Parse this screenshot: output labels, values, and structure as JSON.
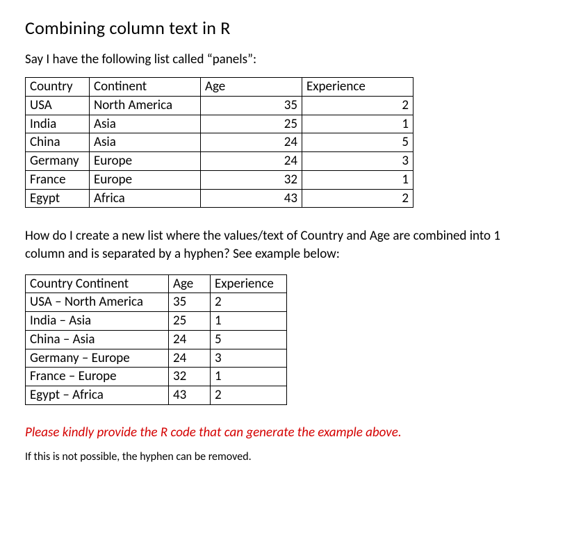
{
  "title": "Combining column text in R",
  "intro": "Say I have the following list called “panels”:",
  "table1": {
    "headers": [
      "Country",
      "Continent",
      "Age",
      "Experience"
    ],
    "rows": [
      {
        "country": "USA",
        "continent": "North America",
        "age": "35",
        "experience": "2"
      },
      {
        "country": "India",
        "continent": "Asia",
        "age": "25",
        "experience": "1"
      },
      {
        "country": "China",
        "continent": "Asia",
        "age": "24",
        "experience": "5"
      },
      {
        "country": "Germany",
        "continent": "Europe",
        "age": "24",
        "experience": "3"
      },
      {
        "country": "France",
        "continent": "Europe",
        "age": "32",
        "experience": "1"
      },
      {
        "country": "Egypt",
        "continent": "Africa",
        "age": "43",
        "experience": "2"
      }
    ]
  },
  "mid": "How do I create a new list where the values/text of Country and Age are combined into 1 column and is separated by a hyphen? See example below:",
  "table2": {
    "headers": [
      "Country Continent",
      "Age",
      "Experience"
    ],
    "rows": [
      {
        "cc": "USA – North America",
        "age": "35",
        "experience": "2"
      },
      {
        "cc": "India – Asia",
        "age": "25",
        "experience": "1"
      },
      {
        "cc": "China – Asia",
        "age": "24",
        "experience": "5"
      },
      {
        "cc": "Germany – Europe",
        "age": "24",
        "experience": "3"
      },
      {
        "cc": "France – Europe",
        "age": "32",
        "experience": "1"
      },
      {
        "cc": "Egypt – Africa",
        "age": "43",
        "experience": "2"
      }
    ]
  },
  "request": "Please kindly provide the R code that can generate the example above.",
  "note": "If this is not possible, the hyphen can be removed."
}
